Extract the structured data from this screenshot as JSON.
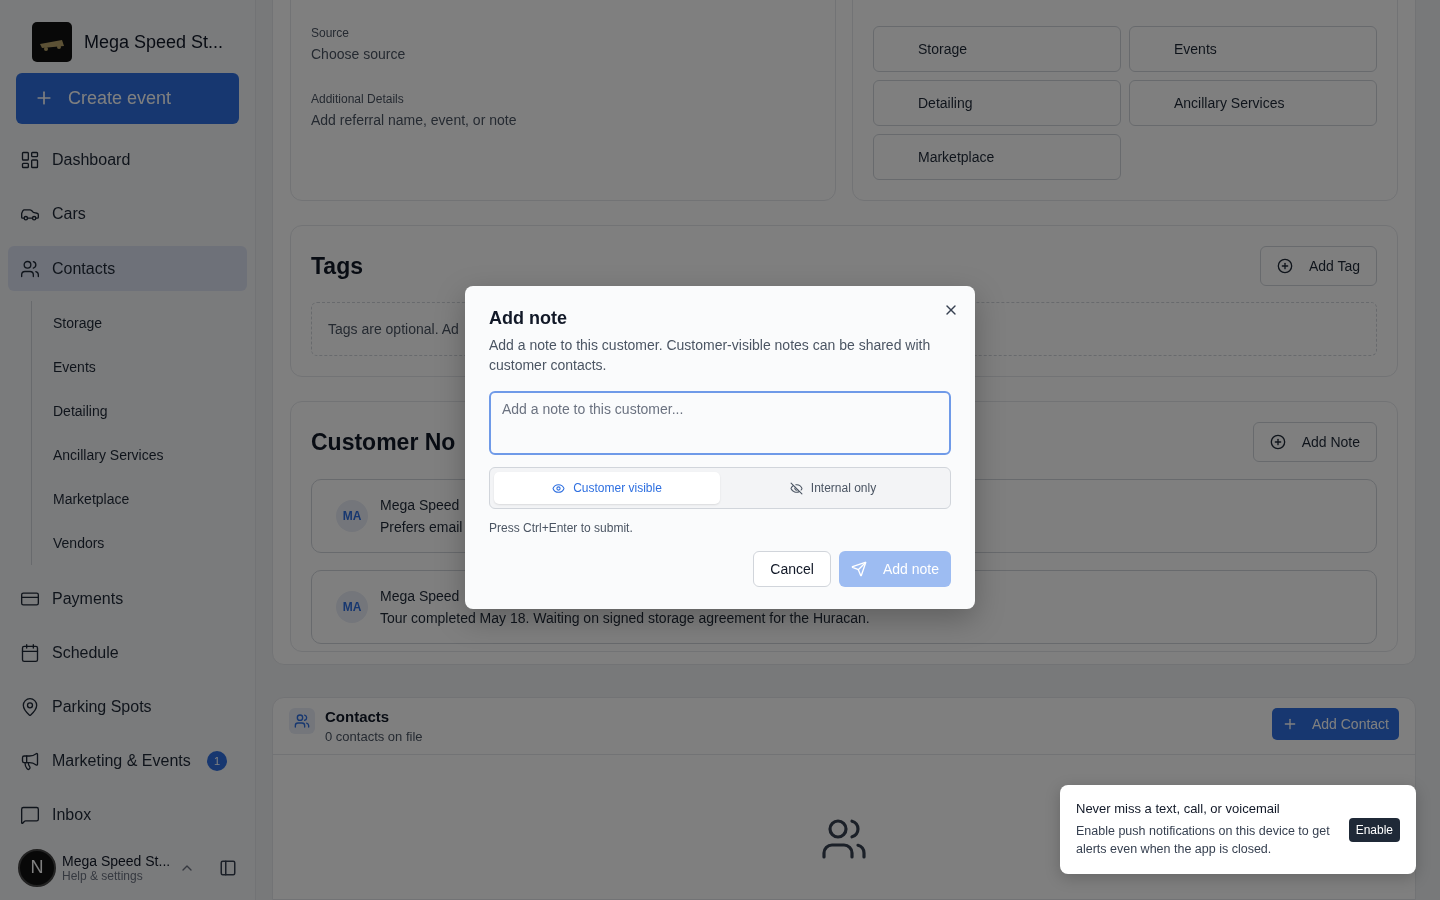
{
  "sidebar": {
    "brand": "Mega Speed St...",
    "create_button": "Create event",
    "items": [
      {
        "label": "Dashboard",
        "selected": false
      },
      {
        "label": "Cars",
        "selected": false
      },
      {
        "label": "Contacts",
        "selected": true,
        "children": [
          {
            "label": "Storage"
          },
          {
            "label": "Events"
          },
          {
            "label": "Detailing"
          },
          {
            "label": "Ancillary Services"
          },
          {
            "label": "Marketplace"
          },
          {
            "label": "Vendors"
          }
        ]
      },
      {
        "label": "Payments",
        "selected": false
      },
      {
        "label": "Schedule",
        "selected": false
      },
      {
        "label": "Parking Spots",
        "selected": false
      },
      {
        "label": "Marketing & Events",
        "selected": false,
        "badge": "1"
      },
      {
        "label": "Inbox",
        "selected": false
      }
    ],
    "account": {
      "initial": "N",
      "name": "Mega Speed St...",
      "subtitle": "Help & settings"
    }
  },
  "customer_source": {
    "fields": [
      {
        "label": "Source",
        "value": "Choose source"
      },
      {
        "label": "Additional Details",
        "value": "Add referral name, event, or note"
      }
    ]
  },
  "customer_groups": {
    "groups": [
      "Storage",
      "Events",
      "Detailing",
      "Ancillary Services",
      "Marketplace"
    ]
  },
  "tags": {
    "title": "Tags",
    "button": "Add Tag",
    "empty_text": "Tags are optional. Ad"
  },
  "customer_notes": {
    "title": "Customer No",
    "button": "Add Note",
    "notes": [
      {
        "initials": "MA",
        "author": "Mega Speed",
        "text": "Prefers email"
      },
      {
        "initials": "MA",
        "author": "Mega Speed",
        "text": "Tour completed May 18. Waiting on signed storage agreement for the Huracan."
      }
    ]
  },
  "contacts": {
    "title": "Contacts",
    "subtitle": "0 contacts on file",
    "button": "Add Contact"
  },
  "dialog": {
    "title": "Add note",
    "description": "Add a note to this customer. Customer-visible notes can be shared with customer contacts.",
    "placeholder": "Add a note to this customer...",
    "visibility": [
      {
        "label": "Customer visible",
        "selected": true
      },
      {
        "label": "Internal only",
        "selected": false
      }
    ],
    "hint": "Press Ctrl+Enter to submit.",
    "cancel": "Cancel",
    "submit": "Add note",
    "submit_disabled": true
  },
  "toast": {
    "title": "Never miss a text, call, or voicemail",
    "message": "Enable push notifications on this device to get alerts even when the app is closed.",
    "button": "Enable"
  }
}
